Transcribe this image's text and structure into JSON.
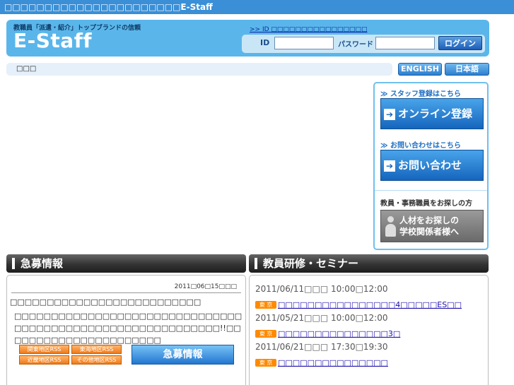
{
  "window": {
    "title": "□□□□□□□□□□□□□□□□□□□□□□E-Staff"
  },
  "header": {
    "tagline": "教職員「派遣・紹介」トップブランドの信頼",
    "logo": "E-Staff",
    "id_link": ">> ID □□□□□□□□□□□□□□□□",
    "id_label": "ID",
    "password_label": "パスワード",
    "login_button": "ログイン",
    "id_value": "",
    "password_value": ""
  },
  "breadcrumb": {
    "text": "□□□"
  },
  "lang": {
    "english": "ENGLISH",
    "japanese": "日本語"
  },
  "side": {
    "staff_head": "≫ スタッフ登録はこちら",
    "online_button": "オンライン登録",
    "contact_head": "≫ お問い合わせはこちら",
    "contact_button": "お問い合わせ",
    "search_head": "教員・事務職員をお探しの方",
    "search_button_line1": "人材をお探しの",
    "search_button_line2": "学校関係者様へ"
  },
  "sections": {
    "kyubo": "急募情報",
    "seminar": "教員研修・セミナー"
  },
  "news": {
    "date": "2011□06□15□□□",
    "title": "□□□□□□□□□□□□□□□□□□□□□□□□□□",
    "body": "□□□□□□□□□□□□□□□□□□□□□□□□□□□□□□□□□□□□□□□□□□□□□□□□□□□□□□□□□□□!!□□□□□□□□□□□□□□□□□□□□□□",
    "rss": [
      "関東地区RSS",
      "東海地区RSS",
      "近畿地区RSS",
      "その他地区RSS"
    ],
    "kyubo_button": "急募情報"
  },
  "seminars": [
    {
      "date": "2011/06/11□□□  10:00□12:00",
      "area": "東 京",
      "title": "□□□□□□□□□□□□□□□□4□□□□□ES□□"
    },
    {
      "date": "2011/05/21□□□  10:00□12:00",
      "area": "東 京",
      "title": "□□□□□□□□□□□□□□□3□"
    },
    {
      "date": "2011/06/21□□□  17:30□19:30",
      "area": "東 京",
      "title": "□□□□□□□□□□□□□□□"
    }
  ]
}
